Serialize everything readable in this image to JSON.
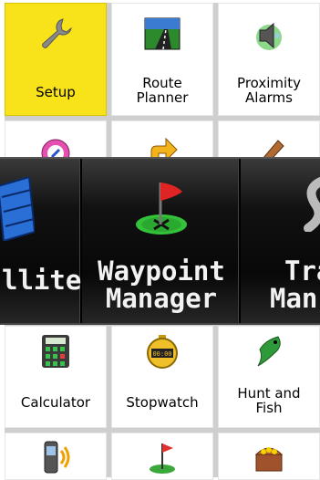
{
  "menu_top": [
    {
      "id": "setup",
      "label_lines": [
        "Setup"
      ],
      "icon": "wrench-icon",
      "selected": true
    },
    {
      "id": "route-planner",
      "label_lines": [
        "Route",
        "Planner"
      ],
      "icon": "road-icon",
      "selected": false
    },
    {
      "id": "proximity-alarms",
      "label_lines": [
        "Proximity",
        "Alarms"
      ],
      "icon": "speaker-icon",
      "selected": false
    }
  ],
  "menu_bottom": [
    {
      "id": "calculator",
      "label_lines": [
        "Calculator"
      ],
      "icon": "calculator-icon"
    },
    {
      "id": "stopwatch",
      "label_lines": [
        "Stopwatch"
      ],
      "icon": "stopwatch-icon"
    },
    {
      "id": "hunt-and-fish",
      "label_lines": [
        "Hunt and",
        "Fish"
      ],
      "icon": "fish-icon"
    }
  ],
  "overlay": {
    "left_panel": {
      "label": "llite",
      "icon": "satellite-icon"
    },
    "center_panel": {
      "label_lines": [
        "Waypoint",
        "Manager"
      ],
      "icon": "flag-icon"
    },
    "right_panel": {
      "label_lines": [
        "Tra",
        "Man"
      ],
      "icon": "track-icon"
    }
  },
  "row_partial_icons": [
    "compass-icon",
    "arrow-icon",
    "pencil-icon"
  ],
  "row_last_icons": [
    "gps-device-icon",
    "golf-flag-icon",
    "treasure-chest-icon"
  ],
  "colors": {
    "selected": "#f8e21a",
    "overlay": "#111111"
  }
}
